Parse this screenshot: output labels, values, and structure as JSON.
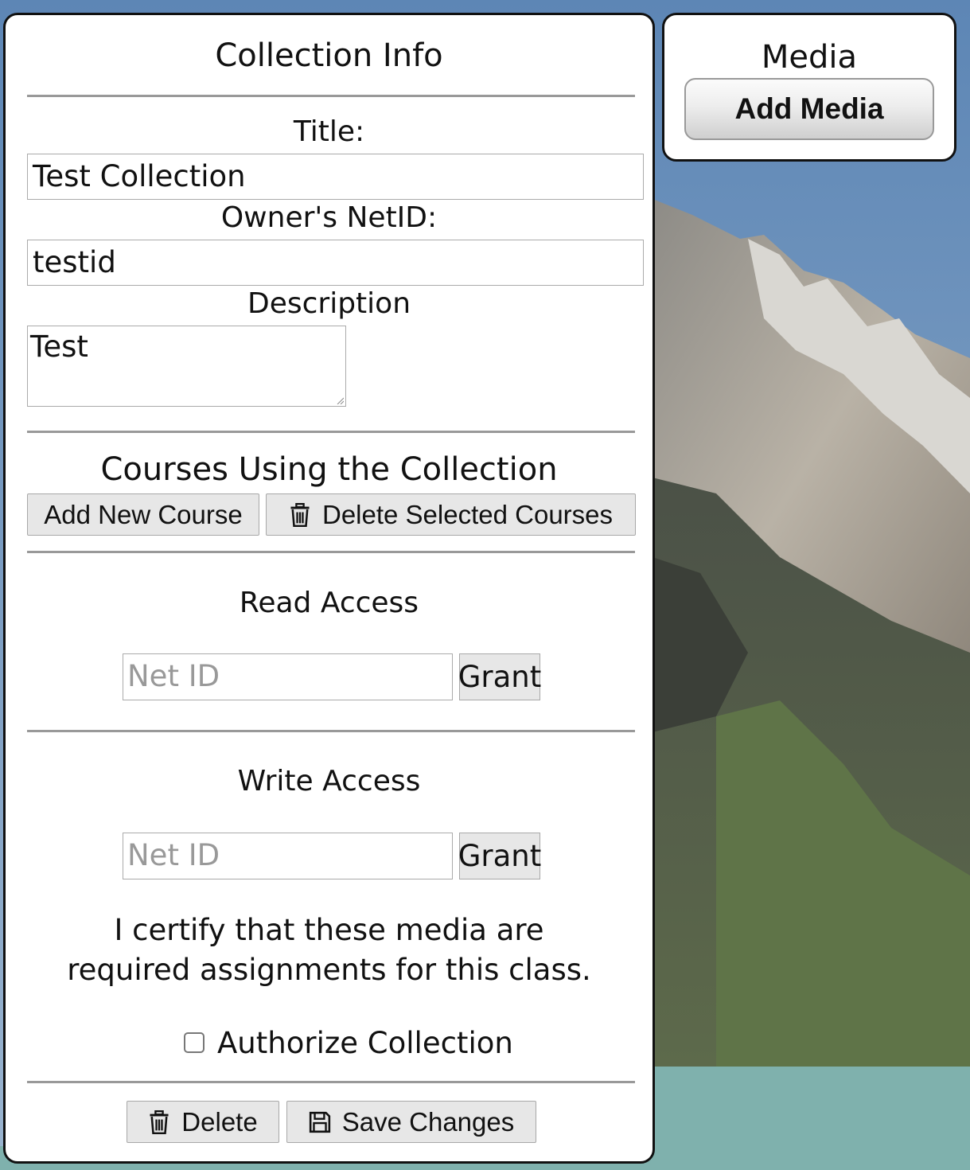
{
  "collection_panel": {
    "heading": "Collection Info",
    "title_label": "Title:",
    "title_value": "Test Collection",
    "owner_label": "Owner's NetID:",
    "owner_value": "testid",
    "description_label": "Description",
    "description_value": "Test",
    "courses_heading": "Courses Using the Collection",
    "add_course_label": "Add New Course",
    "delete_courses_label": "Delete Selected Courses",
    "read_access": {
      "heading": "Read Access",
      "placeholder": "Net ID",
      "grant_label": "Grant"
    },
    "write_access": {
      "heading": "Write Access",
      "placeholder": "Net ID",
      "grant_label": "Grant"
    },
    "certify_text": "I certify that these media are required assignments for this class.",
    "authorize_label": "Authorize Collection",
    "authorize_checked": false,
    "delete_label": "Delete",
    "save_label": "Save Changes"
  },
  "media_panel": {
    "heading": "Media",
    "add_media_label": "Add Media"
  },
  "icons": {
    "trash": "trash-icon",
    "save": "floppy-disk-icon"
  }
}
